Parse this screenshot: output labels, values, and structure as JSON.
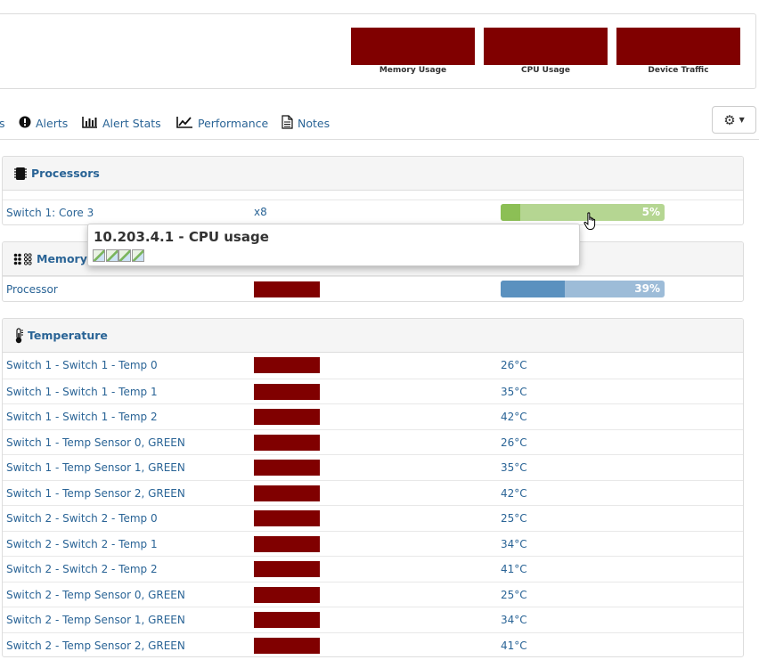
{
  "header_graphs": [
    {
      "caption": "Memory Usage"
    },
    {
      "caption": "CPU Usage"
    },
    {
      "caption": "Device Traffic"
    }
  ],
  "nav": {
    "partial_label": "s",
    "items": [
      {
        "label": "Alerts",
        "icon": "exclamation-circle-icon"
      },
      {
        "label": "Alert Stats",
        "icon": "bar-chart-icon"
      },
      {
        "label": "Performance",
        "icon": "line-chart-icon"
      },
      {
        "label": "Notes",
        "icon": "document-icon"
      }
    ],
    "settings_icon": "gear-icon"
  },
  "processors": {
    "title": "Processors",
    "rows": [
      {
        "name": "Switch 1: Core 3",
        "count": "x8",
        "percent_label": "5%",
        "percent": 5
      }
    ]
  },
  "tooltip": {
    "title": "10.203.4.1 - CPU usage",
    "image_count": 4
  },
  "memory": {
    "title": "Memory",
    "rows": [
      {
        "name": "Processor",
        "percent_label": "39%",
        "percent": 39
      }
    ]
  },
  "temperature": {
    "title": "Temperature",
    "rows": [
      {
        "name": "Switch 1 - Switch 1 - Temp 0",
        "value": "26°C"
      },
      {
        "name": "Switch 1 - Switch 1 - Temp 1",
        "value": "35°C"
      },
      {
        "name": "Switch 1 - Switch 1 - Temp 2",
        "value": "42°C"
      },
      {
        "name": "Switch 1 - Temp Sensor 0, GREEN",
        "value": "26°C"
      },
      {
        "name": "Switch 1 - Temp Sensor 1, GREEN",
        "value": "35°C"
      },
      {
        "name": "Switch 1 - Temp Sensor 2, GREEN",
        "value": "42°C"
      },
      {
        "name": "Switch 2 - Switch 2 - Temp 0",
        "value": "25°C"
      },
      {
        "name": "Switch 2 - Switch 2 - Temp 1",
        "value": "34°C"
      },
      {
        "name": "Switch 2 - Switch 2 - Temp 2",
        "value": "41°C"
      },
      {
        "name": "Switch 2 - Temp Sensor 0, GREEN",
        "value": "25°C"
      },
      {
        "name": "Switch 2 - Temp Sensor 1, GREEN",
        "value": "34°C"
      },
      {
        "name": "Switch 2 - Temp Sensor 2, GREEN",
        "value": "41°C"
      }
    ]
  },
  "colors": {
    "link": "#2a6496",
    "graph_fill": "#800000",
    "cpu_bar": "#8cbf55",
    "mem_bar": "#5b91bf"
  }
}
